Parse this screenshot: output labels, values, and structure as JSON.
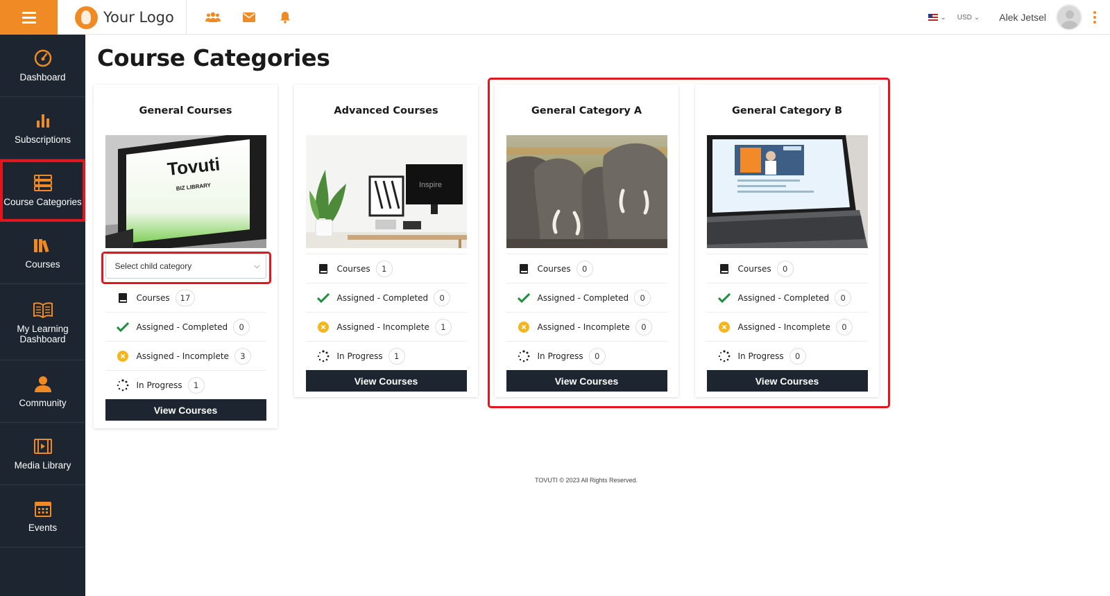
{
  "header": {
    "logo_text": "Your Logo",
    "currency": "USD",
    "username": "Alek Jetsel",
    "accent_color": "#f08a24",
    "icons": [
      "community-icon",
      "mail-icon",
      "bell-icon"
    ]
  },
  "sidebar": {
    "items": [
      {
        "label": "Dashboard",
        "icon": "dashboard-icon"
      },
      {
        "label": "Subscriptions",
        "icon": "bar-chart-icon"
      },
      {
        "label": "Course Categories",
        "icon": "categories-icon",
        "active": true
      },
      {
        "label": "Courses",
        "icon": "books-icon"
      },
      {
        "label": "My Learning Dashboard",
        "icon": "open-book-icon"
      },
      {
        "label": "Community",
        "icon": "users-icon"
      },
      {
        "label": "Media Library",
        "icon": "film-icon"
      },
      {
        "label": "Events",
        "icon": "calendar-icon"
      }
    ]
  },
  "main": {
    "title": "Course Categories",
    "cards": [
      {
        "title": "General Courses",
        "select_placeholder": "Select child category",
        "stats": {
          "courses": "17",
          "completed": "0",
          "incomplete": "3",
          "in_progress": "1"
        },
        "button": "View Courses"
      },
      {
        "title": "Advanced Courses",
        "stats": {
          "courses": "1",
          "completed": "0",
          "incomplete": "1",
          "in_progress": "1"
        },
        "button": "View Courses"
      },
      {
        "title": "General Category A",
        "stats": {
          "courses": "0",
          "completed": "0",
          "incomplete": "0",
          "in_progress": "0"
        },
        "button": "View Courses"
      },
      {
        "title": "General Category B",
        "stats": {
          "courses": "0",
          "completed": "0",
          "incomplete": "0",
          "in_progress": "0"
        },
        "button": "View Courses"
      }
    ],
    "stat_labels": {
      "courses": "Courses",
      "completed": "Assigned - Completed",
      "incomplete": "Assigned - Incomplete",
      "in_progress": "In Progress"
    },
    "image_texts": {
      "laptop_brand": "Tovuti",
      "laptop_sub": "BIZ LIBRARY",
      "monitor_text": "Inspire"
    }
  },
  "footer": {
    "text": "TOVUTI © 2023 All Rights Reserved."
  }
}
